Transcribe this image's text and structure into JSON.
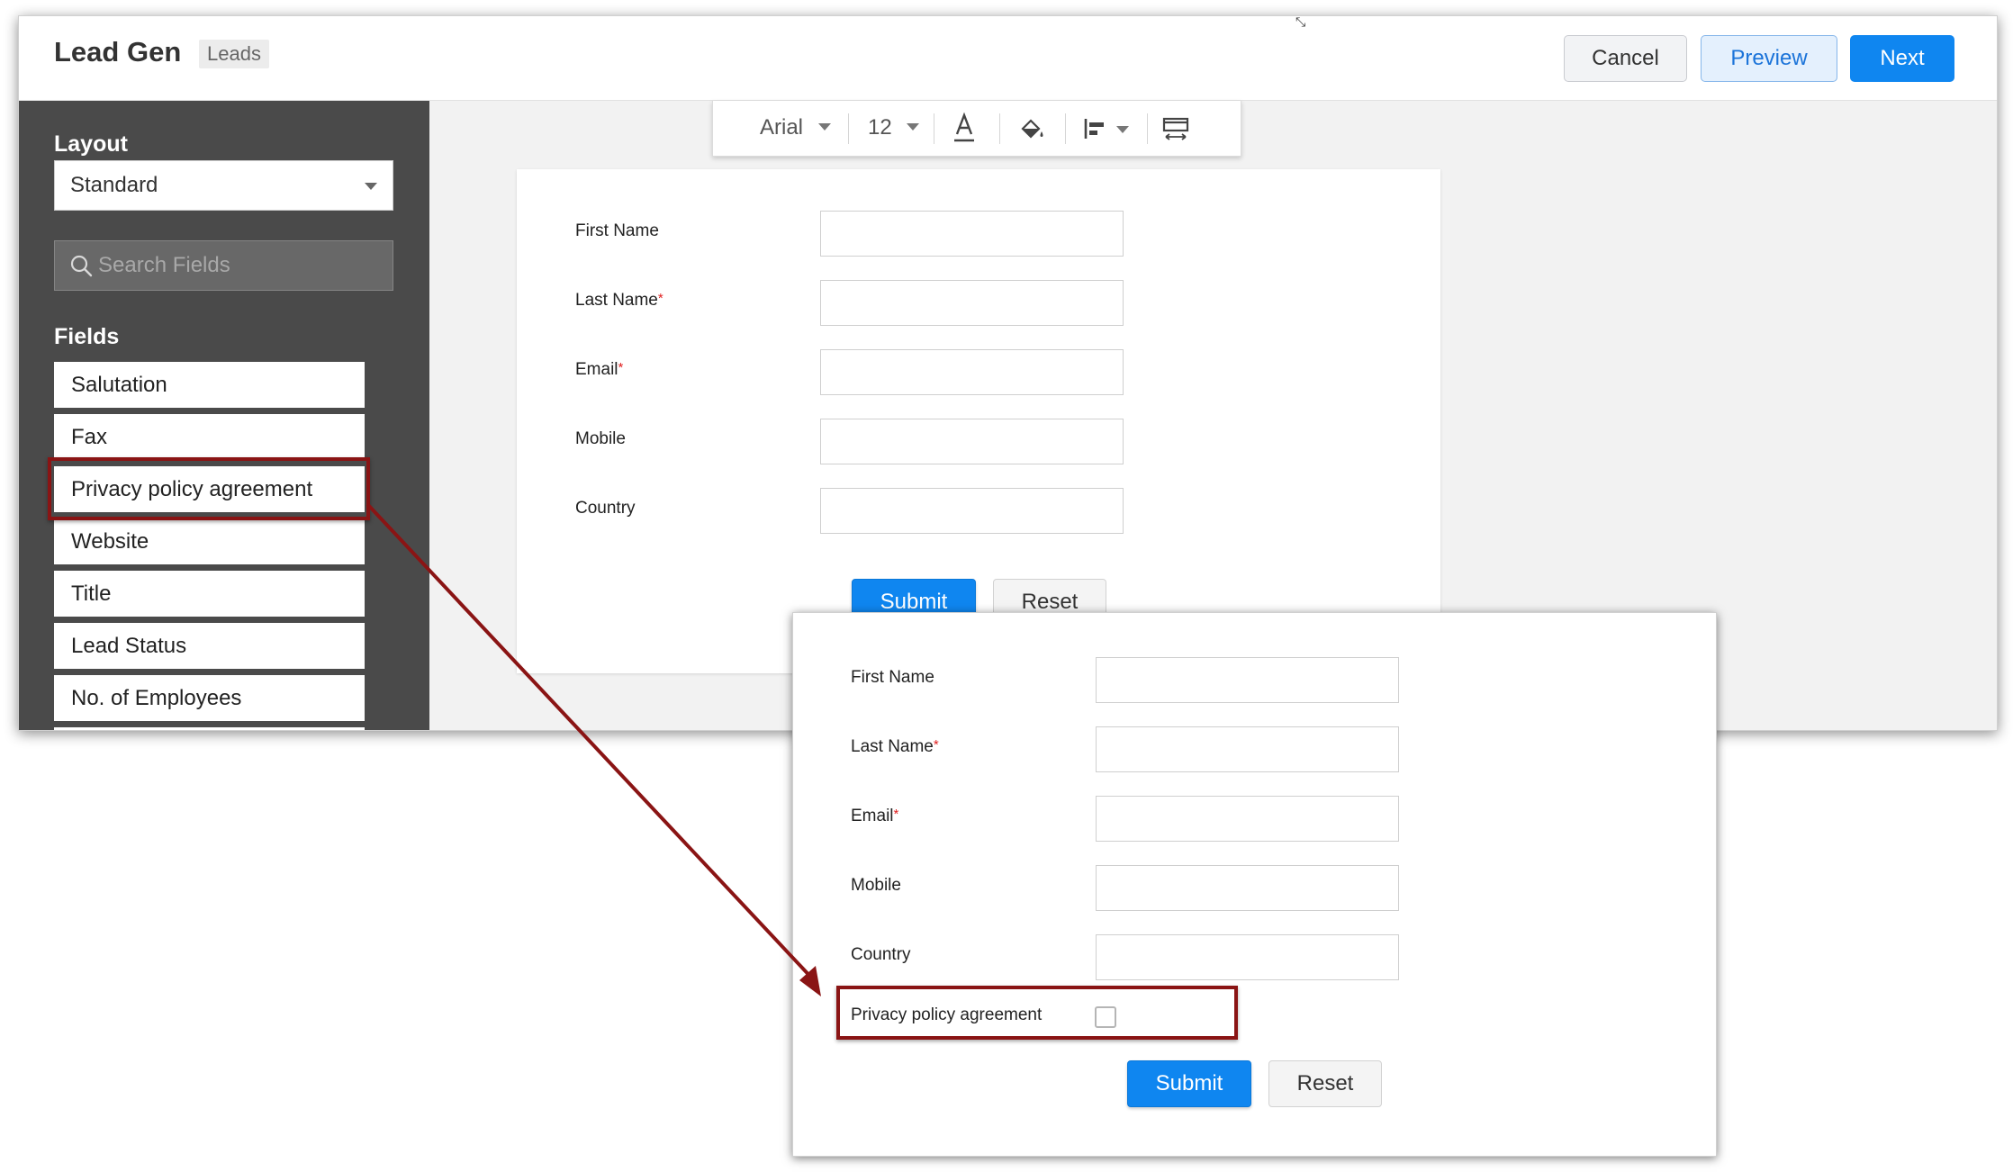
{
  "header": {
    "title": "Lead Gen",
    "module_badge": "Leads",
    "buttons": {
      "cancel": "Cancel",
      "preview": "Preview",
      "next": "Next"
    }
  },
  "sidebar": {
    "layout_heading": "Layout",
    "layout_value": "Standard",
    "search_placeholder": "Search Fields",
    "fields_heading": "Fields",
    "fields": [
      "Salutation",
      "Fax",
      "Privacy policy agreement",
      "Website",
      "Title",
      "Lead Status",
      "No. of Employees"
    ],
    "highlighted_field": "Privacy policy agreement"
  },
  "toolbar": {
    "font_family": "Arial",
    "font_size": "12",
    "icons": [
      "text-color-icon",
      "fill-color-icon",
      "align-left-icon",
      "layout-width-icon"
    ]
  },
  "form": {
    "fields": [
      {
        "label": "First Name",
        "required": false,
        "value": ""
      },
      {
        "label": "Last Name",
        "required": true,
        "value": ""
      },
      {
        "label": "Email",
        "required": true,
        "value": ""
      },
      {
        "label": "Mobile",
        "required": false,
        "value": ""
      },
      {
        "label": "Country",
        "required": false,
        "value": ""
      }
    ],
    "required_marker": "*",
    "submit_label": "Submit",
    "reset_label": "Reset"
  },
  "preview_form": {
    "fields": [
      {
        "label": "First Name",
        "required": false,
        "value": ""
      },
      {
        "label": "Last Name",
        "required": true,
        "value": ""
      },
      {
        "label": "Email",
        "required": true,
        "value": ""
      },
      {
        "label": "Mobile",
        "required": false,
        "value": ""
      },
      {
        "label": "Country",
        "required": false,
        "value": ""
      }
    ],
    "checkbox_field": {
      "label": "Privacy policy agreement",
      "checked": false
    },
    "submit_label": "Submit",
    "reset_label": "Reset"
  },
  "colors": {
    "primary": "#0f86f0",
    "sidebar_bg": "#4a4a4a",
    "highlight": "#8a1414",
    "required": "#e02020"
  }
}
